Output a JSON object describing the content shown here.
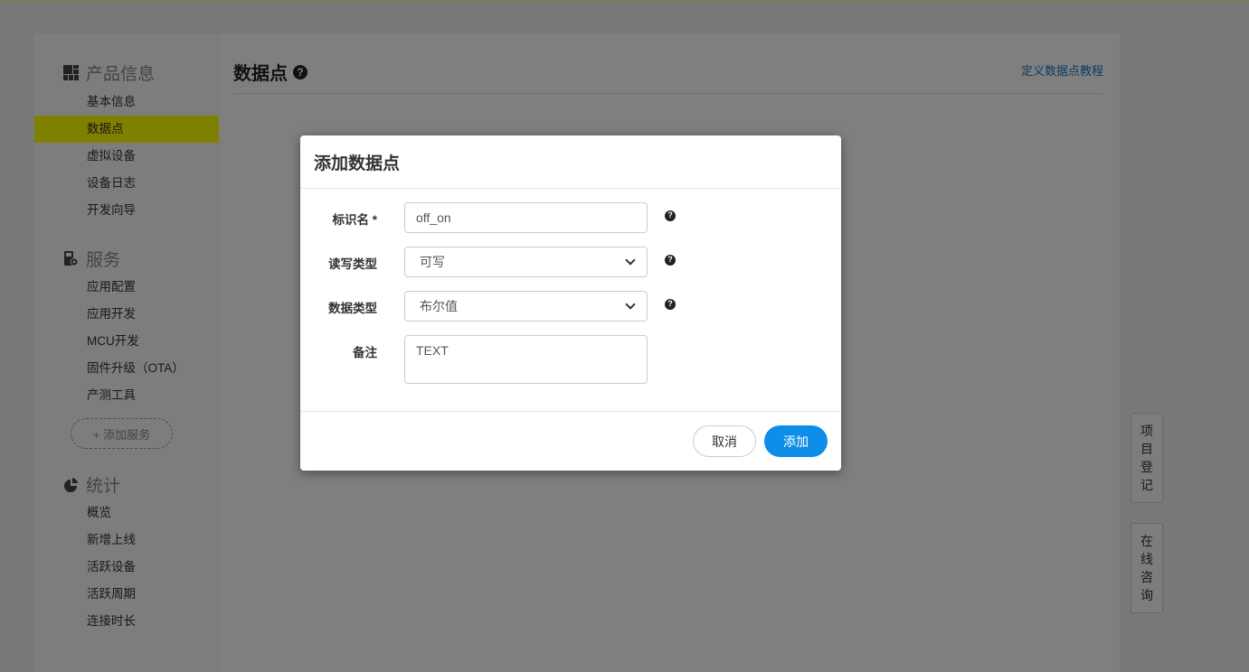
{
  "sidebar": {
    "sections": [
      {
        "title": "产品信息",
        "icon": "grid-icon",
        "items": [
          {
            "label": "基本信息",
            "active": false
          },
          {
            "label": "数据点",
            "active": true
          },
          {
            "label": "虚拟设备",
            "active": false
          },
          {
            "label": "设备日志",
            "active": false
          },
          {
            "label": "开发向导",
            "active": false
          }
        ]
      },
      {
        "title": "服务",
        "icon": "service-gear-icon",
        "items": [
          {
            "label": "应用配置"
          },
          {
            "label": "应用开发"
          },
          {
            "label": "MCU开发"
          },
          {
            "label": "固件升级（OTA）"
          },
          {
            "label": "产测工具"
          }
        ],
        "add_button": "+ 添加服务"
      },
      {
        "title": "统计",
        "icon": "pie-chart-icon",
        "items": [
          {
            "label": "概览"
          },
          {
            "label": "新增上线"
          },
          {
            "label": "活跃设备"
          },
          {
            "label": "活跃周期"
          },
          {
            "label": "连接时长"
          }
        ]
      }
    ],
    "active_color": "#ffff00"
  },
  "main": {
    "title": "数据点",
    "tutorial_link": "定义数据点教程"
  },
  "side_buttons": [
    {
      "label": [
        "项",
        "目",
        "登",
        "记"
      ]
    },
    {
      "label": [
        "在",
        "线",
        "咨",
        "询"
      ]
    }
  ],
  "modal": {
    "title": "添加数据点",
    "fields": {
      "identifier": {
        "label": "标识名 *",
        "value": "off_on"
      },
      "rw_type": {
        "label": "读写类型",
        "value": "可写"
      },
      "data_type": {
        "label": "数据类型",
        "value": "布尔值"
      },
      "remark": {
        "label": "备注",
        "value": "TEXT"
      }
    },
    "cancel_label": "取消",
    "add_label": "添加",
    "primary_color": "#0e8ee9"
  }
}
